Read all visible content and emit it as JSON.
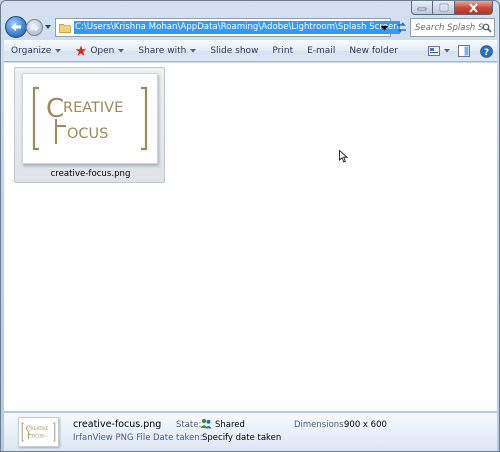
{
  "window": {
    "address": "C:\\Users\\Krishna Mohan\\AppData\\Roaming\\Adobe\\Lightroom\\Splash Screen",
    "search_placeholder": "Search Splash Scr..."
  },
  "commands": {
    "organize": "Organize",
    "open": "Open",
    "share_with": "Share with",
    "slide_show": "Slide show",
    "print": "Print",
    "email": "E-mail",
    "new_folder": "New folder"
  },
  "files": [
    {
      "name": "creative-focus.png",
      "thumbnail_text": [
        "CREATIVE",
        "FOCUS"
      ]
    }
  ],
  "details": {
    "name": "creative-focus.png",
    "type": "IrfanView PNG File",
    "state_label": "State:",
    "state_value": "Shared",
    "date_label": "Date taken:",
    "date_value": "Specify date taken",
    "dimensions_label": "Dimensions:",
    "dimensions_value": "900 x 600"
  },
  "colors": {
    "logo_gold": "#9a8a5e",
    "selection_blue": "#3399ff",
    "close_red": "#c8472f"
  }
}
